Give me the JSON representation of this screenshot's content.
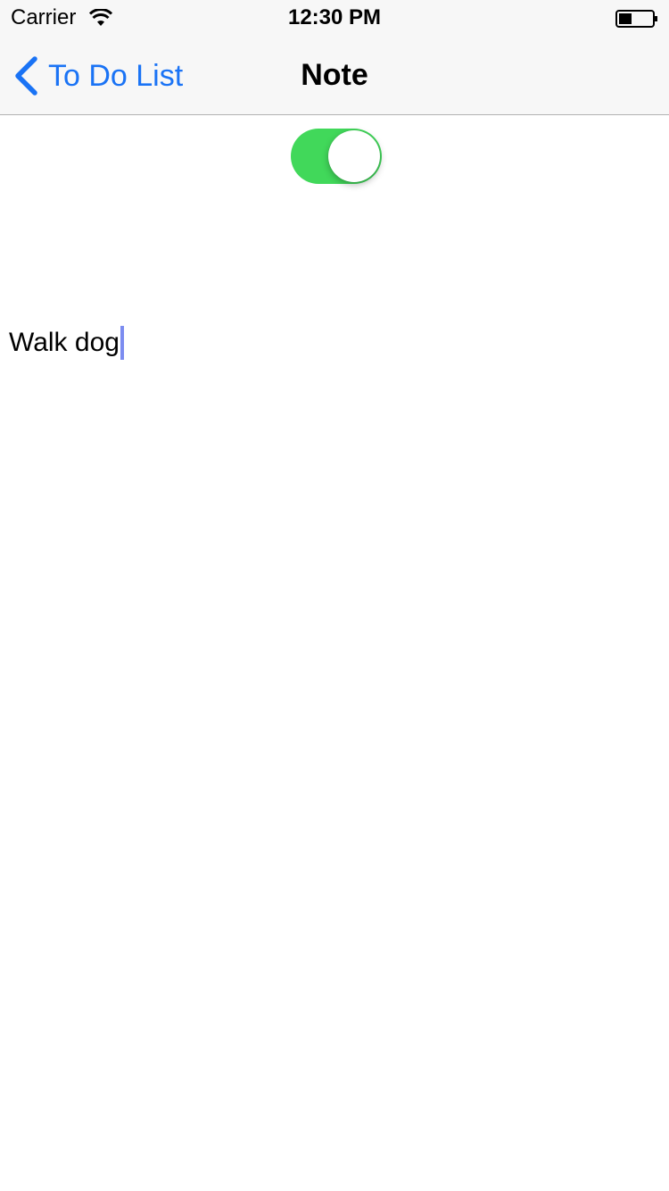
{
  "status_bar": {
    "carrier": "Carrier",
    "time": "12:30 PM",
    "battery_level": 0.4
  },
  "nav": {
    "back_label": "To Do List",
    "title": "Note"
  },
  "toggle": {
    "on": true,
    "color": "#41d85a"
  },
  "note": {
    "value": "Walk dog"
  },
  "colors": {
    "accent": "#1a73f5",
    "caret": "#7c8cf0",
    "nav_background": "#f7f7f7"
  },
  "icons": [
    "wifi-icon",
    "battery-icon",
    "back-chevron-icon"
  ]
}
